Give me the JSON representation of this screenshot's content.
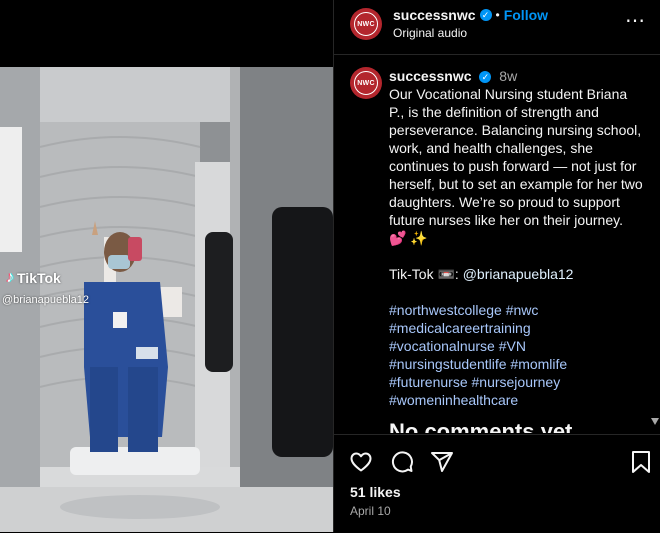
{
  "header": {
    "username": "successnwc",
    "follow_label": "Follow",
    "dot": "•",
    "subtitle": "Original audio",
    "more_glyph": "⋯"
  },
  "avatar_text": "NWC",
  "overlay": {
    "tiktok_label": "TikTok",
    "tiktok_handle": "@brianapuebla12"
  },
  "caption": {
    "username": "successnwc",
    "time": "8w",
    "body": "Our Vocational Nursing student Briana P., is the definition of strength and perseverance. Balancing nursing school, work, and health challenges, she continues to push forward — not just for herself, but to set an example for her two daughters. We’re so proud to support future nurses like her on their journey. 💕 ✨",
    "tiktok_prefix": "Tik-Tok 📼: ",
    "tiktok_mention": "@brianapuebla12",
    "hashtag_lines": [
      "#northwestcollege #nwc",
      "#medicalcareertraining",
      "#vocationalnurse #VN",
      "#nursingstudentlife #momlife",
      "#futurenurse #nursejourney",
      "#womeninhealthcare"
    ],
    "no_comments": "No comments yet"
  },
  "footer": {
    "likes": "51 likes",
    "date": "April 10"
  },
  "icons": {
    "like": "heart-icon",
    "comment": "comment-icon",
    "share": "share-icon",
    "save": "bookmark-icon"
  },
  "colors": {
    "accent_blue": "#0095f6",
    "hashtag": "#a8c7fa",
    "brand_red": "#b3262d"
  }
}
